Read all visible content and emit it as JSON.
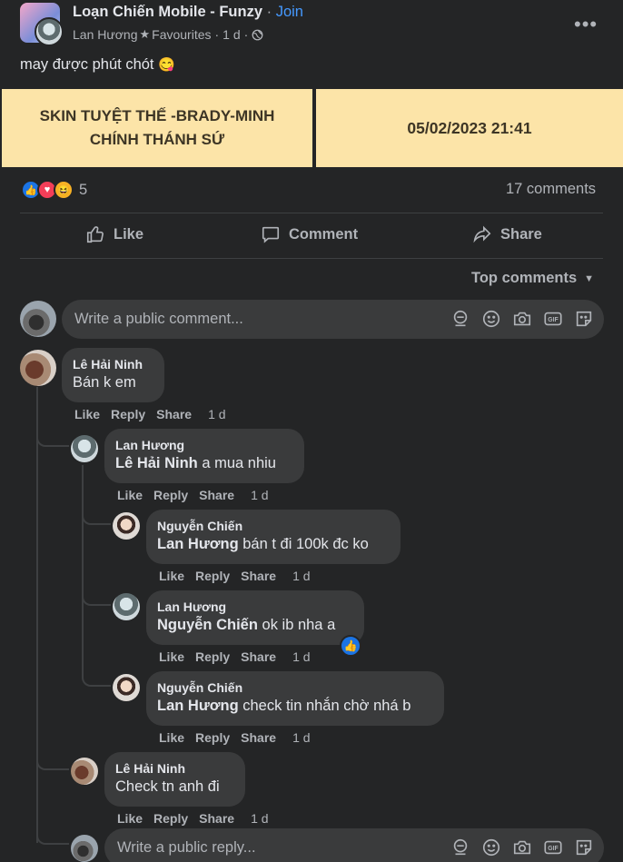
{
  "post": {
    "group_name": "Loạn Chiến Mobile - Funzy",
    "separator": "·",
    "join_label": "Join",
    "author": "Lan Hương",
    "author_badge": "Favourites",
    "time": "1 d",
    "text": "may được phút chót",
    "text_emoji": "😋"
  },
  "banner": {
    "left_line1": "SKIN TUYỆT THẾ -BRADY-MINH",
    "left_line2": "CHÍNH THÁNH SỨ",
    "right": "05/02/2023 21:41",
    "bg_color": "#fce4a8",
    "text_color": "#3d3525"
  },
  "reactions": {
    "count": "5",
    "comments": "17 comments"
  },
  "action_bar": {
    "like": "Like",
    "comment": "Comment",
    "share": "Share"
  },
  "sort": {
    "label": "Top comments"
  },
  "composer": {
    "placeholder": "Write a public comment..."
  },
  "reply_composer": {
    "placeholder": "Write a public reply..."
  },
  "comments": [
    {
      "name": "Lê Hải Ninh",
      "tag": "",
      "text": "Bán k em",
      "like": "Like",
      "reply": "Reply",
      "share": "Share",
      "time": "1 d"
    },
    {
      "name": "Lan Hương",
      "tag": "Lê Hải Ninh",
      "text": " a mua nhiu",
      "like": "Like",
      "reply": "Reply",
      "share": "Share",
      "time": "1 d"
    },
    {
      "name": "Nguyễn Chiến",
      "tag": "Lan Hương",
      "text": " bán t đi 100k đc ko",
      "like": "Like",
      "reply": "Reply",
      "share": "Share",
      "time": "1 d"
    },
    {
      "name": "Lan Hương",
      "tag": "Nguyễn Chiến",
      "text": " ok ib nha a",
      "like": "Like",
      "reply": "Reply",
      "share": "Share",
      "time": "1 d"
    },
    {
      "name": "Nguyễn Chiến",
      "tag": "Lan Hương",
      "text": " check tin nhắn chờ nhá b",
      "like": "Like",
      "reply": "Reply",
      "share": "Share",
      "time": "1 d"
    },
    {
      "name": "Lê Hải Ninh",
      "tag": "",
      "text": "Check tn anh đi",
      "like": "Like",
      "reply": "Reply",
      "share": "Share",
      "time": "1 d"
    }
  ],
  "colors": {
    "link": "#4599ff",
    "bg": "#242526",
    "bubble": "#3a3b3c"
  }
}
